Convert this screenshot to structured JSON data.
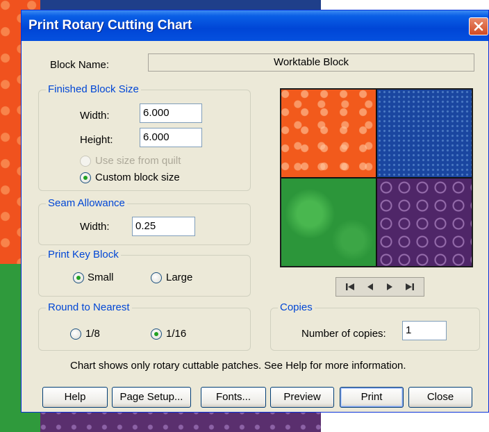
{
  "dialog": {
    "title": "Print Rotary Cutting Chart",
    "close_icon": "close-icon"
  },
  "block_name": {
    "label": "Block Name:",
    "value": "Worktable Block"
  },
  "finished_block_size": {
    "legend": "Finished Block Size",
    "width_label": "Width:",
    "width_value": "6.000",
    "height_label": "Height:",
    "height_value": "6.000",
    "use_size_from_quilt_label": "Use size from quilt",
    "use_size_from_quilt_selected": false,
    "use_size_from_quilt_enabled": false,
    "custom_block_size_label": "Custom block size",
    "custom_block_size_selected": true
  },
  "seam_allowance": {
    "legend": "Seam Allowance",
    "width_label": "Width:",
    "width_value": "0.25"
  },
  "print_key_block": {
    "legend": "Print Key Block",
    "options": [
      {
        "label": "Small",
        "selected": true
      },
      {
        "label": "Large",
        "selected": false
      }
    ]
  },
  "round_to_nearest": {
    "legend": "Round to Nearest",
    "options": [
      {
        "label": "1/8",
        "selected": false
      },
      {
        "label": "1/16",
        "selected": true
      }
    ]
  },
  "copies": {
    "legend": "Copies",
    "label": "Number of copies:",
    "value": "1"
  },
  "preview": {
    "quadrants": [
      {
        "name": "orange-star-fabric",
        "color": "#f25a1c"
      },
      {
        "name": "blue-dotted-fabric",
        "color": "#1a46a0"
      },
      {
        "name": "green-mottled-fabric",
        "color": "#2c963a"
      },
      {
        "name": "purple-swirl-fabric",
        "color": "#4f2668"
      }
    ]
  },
  "navigation": {
    "icons": [
      "first-icon",
      "previous-icon",
      "next-icon",
      "last-icon"
    ]
  },
  "info_text": "Chart shows only rotary cuttable patches. See Help for more information.",
  "buttons": {
    "help": "Help",
    "page_setup": "Page Setup...",
    "fonts": "Fonts...",
    "preview": "Preview",
    "print": "Print",
    "close": "Close"
  },
  "colors": {
    "titlebar": "#0046d6",
    "dialog_background": "#ece9d8",
    "group_legend": "#0046d5",
    "close_button": "#d24a22"
  }
}
